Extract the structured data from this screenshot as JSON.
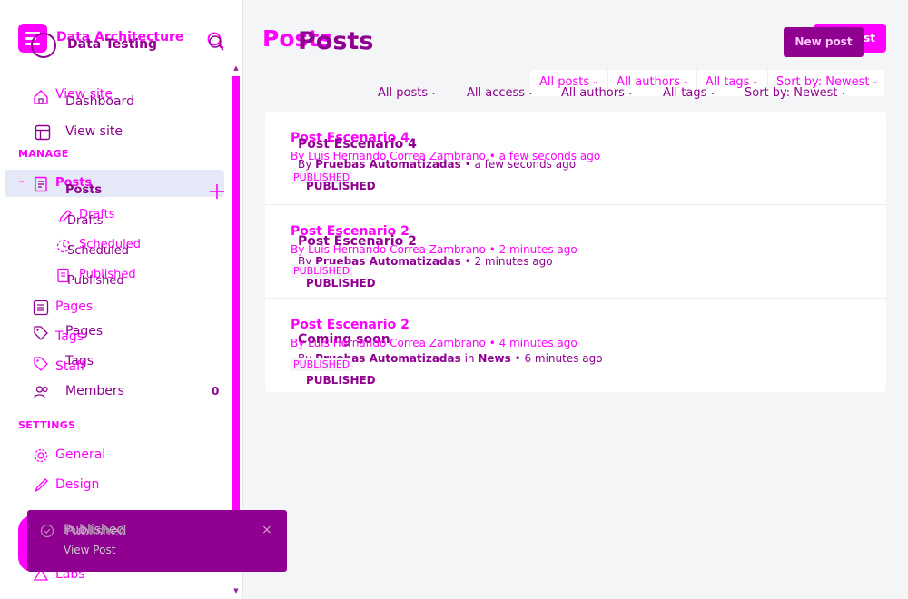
{
  "site": {
    "name_primary": "Data Architecture",
    "name_secondary": "Data Testing"
  },
  "nav": {
    "view_site_primary": "View site",
    "dashboard": "Dashboard",
    "view_site": "View site",
    "manage_heading": "MANAGE",
    "posts_primary": "Posts",
    "posts": "Posts",
    "drafts_primary": "Drafts",
    "drafts": "Drafts",
    "scheduled_primary": "Scheduled",
    "scheduled": "Scheduled",
    "published_primary": "Published",
    "published": "Published",
    "pages_primary": "Pages",
    "pages": "Pages",
    "tags_primary": "Tags",
    "tags": "Tags",
    "staff_primary": "Staff",
    "members": "Members",
    "members_count": "0",
    "settings_heading": "SETTINGS",
    "general": "General",
    "design": "Design",
    "labs": "Labs"
  },
  "toast": {
    "title": "Published",
    "title_secondary": "Published",
    "link": "View Post",
    "close": "×"
  },
  "header": {
    "title_primary": "Posts",
    "title": "Posts",
    "new_post_primary": "New post",
    "new_post": "New post"
  },
  "filters": {
    "top": [
      "All posts",
      "All authors",
      "All tags",
      "Sort by: Newest"
    ],
    "bottom": [
      "All posts",
      "All access",
      "All authors",
      "All tags",
      "Sort by: Newest"
    ]
  },
  "posts": [
    {
      "title_primary": "Post Escenario 4",
      "title": "Post Escenario 4",
      "meta_primary": "By Luis Hernando Correa Zambrano • a few seconds ago",
      "meta_by": "By",
      "meta_author": "Pruebas Automatizadas",
      "meta_rest": " • a few seconds ago",
      "status_primary": "PUBLISHED",
      "status": "PUBLISHED"
    },
    {
      "title_primary": "Post Escenario 2",
      "title": "Post Escenario 2",
      "meta_primary": "By Luis Hernando Correa Zambrano • 2 minutes ago",
      "meta_by": "By",
      "meta_author": "Pruebas Automatizadas",
      "meta_rest": " • 2 minutes ago",
      "status_primary": "PUBLISHED",
      "status": "PUBLISHED"
    },
    {
      "title_primary": "Post Escenario 2",
      "title": "Coming soon",
      "meta_primary": "By Luis Hernando Correa Zambrano • 4 minutes ago",
      "meta_by": "By",
      "meta_author": "Pruebas Automatizadas",
      "meta_mid": " in ",
      "meta_tag": "News",
      "meta_rest": " • 6 minutes ago",
      "status_primary": "PUBLISHED",
      "status": "PUBLISHED"
    }
  ],
  "colors": {
    "magenta": "#ff00ff",
    "purple": "#900090",
    "active_bg": "#e5e8f6"
  }
}
